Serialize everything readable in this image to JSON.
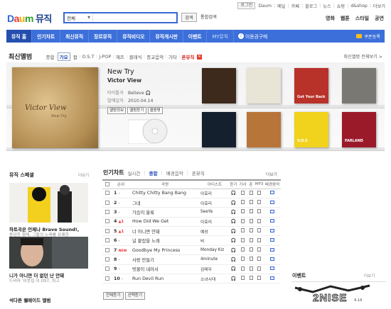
{
  "util": {
    "login": "로그인",
    "links": [
      "Daum",
      "메일",
      "카페",
      "블로그",
      "뉴스",
      "쇼핑",
      "d&shop",
      "더보기"
    ]
  },
  "logo": {
    "d": "D",
    "a": "a",
    "u": "u",
    "m": "m",
    "title": "뮤직"
  },
  "search": {
    "scope": "전체",
    "value": "",
    "button": "검색",
    "integrated": "통합검색"
  },
  "topnav": [
    "영화",
    "웹툰",
    "스타일",
    "공연"
  ],
  "mainnav": {
    "items": [
      "뮤직 홈",
      "인기차트",
      "최신뮤직",
      "장르뮤직",
      "뮤직비디오",
      "뮤직게시판",
      "이벤트",
      "MY뮤직"
    ],
    "ticket": "이용권구매",
    "coupon": "쿠폰등록"
  },
  "newalbums": {
    "title": "최신앨범",
    "tabs": [
      "종합",
      "가요",
      "팝",
      "O.S.T",
      "J-POP",
      "재즈",
      "클래식",
      "종교음악",
      "기타",
      "폰뮤직"
    ],
    "new_badge": "N",
    "all_link": "최신앨범 전체보기 >",
    "featured": {
      "art_title": "Victor View",
      "art_sub": "New Try",
      "title": "New Try",
      "artist": "Victor View",
      "title_label": "타이틀곡",
      "title_song": "Believe",
      "date_label": "발매일자",
      "date": "2010.04.14",
      "buttons": [
        "앨범정보",
        "앨범듣기",
        "앨범평"
      ]
    },
    "gallery": [
      {
        "name": "",
        "color": "#3d2a1c"
      },
      {
        "name": "",
        "color": "#e8e4d6"
      },
      {
        "name": "Got Your Back",
        "color": "#b8322a"
      },
      {
        "name": "",
        "color": "#7a7872"
      },
      {
        "name": "",
        "color": "#15202f"
      },
      {
        "name": "",
        "color": "#b7753a"
      },
      {
        "name": "V.O.S",
        "color": "#f1d21d"
      },
      {
        "name": "FARLAND",
        "color": "#9a1a2a"
      }
    ]
  },
  "leftcol": {
    "title": "뮤직 스페셜",
    "more": "더보기",
    "items": [
      {
        "title": "하트곡은 언제나 Brave Sound!,",
        "desc": "용감한 형제, 그들의 노래를 유쾌한"
      },
      {
        "title": "니가 아니면 더 없던 난 안돼",
        "desc": "드라마 '이웃집 이 OST, 최고"
      }
    ],
    "bottom": "석다른 웰메이드 앨범"
  },
  "chart": {
    "title": "인기차트",
    "tabs": [
      "실시간",
      "종합",
      "배경음악",
      "폰뮤직"
    ],
    "more": "더보기",
    "columns": [
      "순위",
      "곡명",
      "아티스트",
      "듣기",
      "가사",
      "폰",
      "MP3",
      "배경음악"
    ],
    "rows": [
      {
        "rank": "1",
        "chg": "-",
        "title": "Chitty Chitty Bang Bang",
        "artist": "이효리"
      },
      {
        "rank": "2",
        "chg": "-",
        "title": "그네",
        "artist": "이효리"
      },
      {
        "rank": "3",
        "chg": "-",
        "title": "가슴이 울룩",
        "artist": "SeeYa"
      },
      {
        "rank": "4",
        "chg": "▲1",
        "title": "How Did We Get",
        "artist": "이효리"
      },
      {
        "rank": "5",
        "chg": "▲1",
        "title": "너 아니면 안돼",
        "artist": "예성"
      },
      {
        "rank": "6",
        "chg": "-",
        "title": "널 붙잡을 노래",
        "artist": "비"
      },
      {
        "rank": "7",
        "chg": "NEW",
        "title": "Goodbye My Princess",
        "artist": "Monday Kiz"
      },
      {
        "rank": "8",
        "chg": "-",
        "title": "사랑 만들기",
        "artist": "4minute"
      },
      {
        "rank": "9",
        "chg": "-",
        "title": "빗물이 내려서",
        "artist": "김태우"
      },
      {
        "rank": "10",
        "chg": "-",
        "title": "Run Devil Run",
        "artist": "소녀시대"
      }
    ],
    "buttons": [
      "전체듣기",
      "선택듣기"
    ]
  },
  "event": {
    "title": "이벤트",
    "more": "더보기",
    "banner": "2NISE",
    "date": "4.14"
  }
}
